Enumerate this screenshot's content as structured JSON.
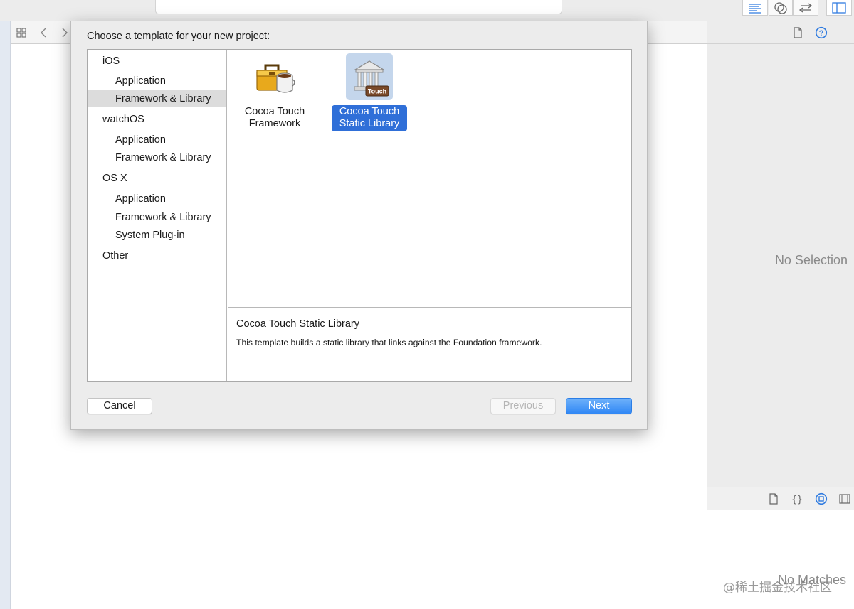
{
  "dialog": {
    "title": "Choose a template for your new project:",
    "sidebar": [
      {
        "label": "iOS",
        "kind": "platform",
        "selected": false
      },
      {
        "label": "Application",
        "kind": "sub",
        "selected": false
      },
      {
        "label": "Framework & Library",
        "kind": "sub",
        "selected": true
      },
      {
        "label": "watchOS",
        "kind": "platform",
        "selected": false
      },
      {
        "label": "Application",
        "kind": "sub",
        "selected": false
      },
      {
        "label": "Framework & Library",
        "kind": "sub",
        "selected": false
      },
      {
        "label": "OS X",
        "kind": "platform",
        "selected": false
      },
      {
        "label": "Application",
        "kind": "sub",
        "selected": false
      },
      {
        "label": "Framework & Library",
        "kind": "sub",
        "selected": false
      },
      {
        "label": "System Plug-in",
        "kind": "sub",
        "selected": false
      },
      {
        "label": "Other",
        "kind": "platform",
        "selected": false
      }
    ],
    "templates": [
      {
        "line1": "Cocoa Touch",
        "line2": "Framework",
        "icon": "toolbox-icon",
        "selected": false
      },
      {
        "line1": "Cocoa Touch",
        "line2": "Static Library",
        "icon": "library-building-icon",
        "badge": "Touch",
        "selected": true
      }
    ],
    "description": {
      "title": "Cocoa Touch Static Library",
      "text": "This template builds a static library that links against the Foundation framework."
    },
    "buttons": {
      "cancel": "Cancel",
      "previous": "Previous",
      "next": "Next"
    }
  },
  "inspector": {
    "no_selection": "No Selection",
    "no_matches": "No Matches"
  },
  "watermark": "@稀土掘金技术社区",
  "colors": {
    "accent": "#2f6fd8",
    "next_button": "#3d8ff6",
    "selection_bg": "#dcdcdc"
  }
}
